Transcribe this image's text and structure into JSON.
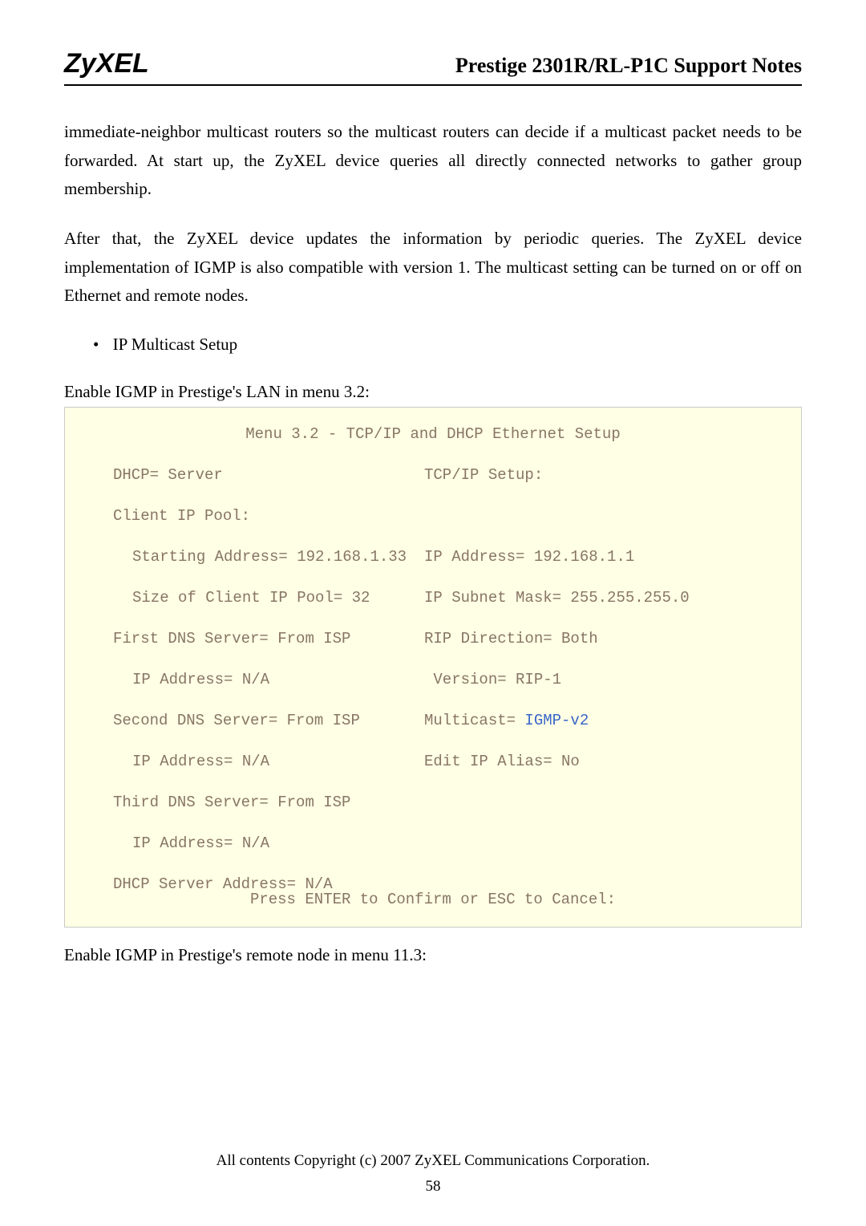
{
  "header": {
    "logo": "ZyXEL",
    "title": "Prestige 2301R/RL-P1C Support Notes"
  },
  "para1": "immediate-neighbor multicast routers so the multicast routers can decide if a multicast packet needs to be forwarded. At start up, the ZyXEL device queries all directly connected networks to gather group membership.",
  "para2": "After that, the ZyXEL device updates the information by periodic queries. The ZyXEL device implementation of IGMP is also compatible with version 1. The multicast setting can be turned on or off on Ethernet and remote nodes.",
  "bullet": "IP Multicast Setup",
  "caption1": "Enable IGMP in Prestige's LAN in menu 3.2:",
  "terminal": {
    "title": "Menu 3.2 - TCP/IP and DHCP Ethernet Setup",
    "rows": [
      {
        "l": "DHCP= Server",
        "r": "TCP/IP Setup:",
        "li": "i1",
        "ri": ""
      },
      {
        "l": "Client IP Pool:",
        "r": "",
        "li": "i1",
        "ri": ""
      },
      {
        "l": "Starting Address= 192.168.1.33",
        "r": "IP Address= 192.168.1.1",
        "li": "i2",
        "ri": ""
      },
      {
        "l": "Size of Client IP Pool= 32",
        "r": "IP Subnet Mask= 255.255.255.0",
        "li": "i2",
        "ri": ""
      },
      {
        "l": "First DNS Server= From ISP",
        "r": "RIP Direction= Both",
        "li": "i1",
        "ri": ""
      },
      {
        "l": "IP Address= N/A",
        "r": " Version= RIP-1",
        "li": "i2",
        "ri": ""
      },
      {
        "l": "Second DNS Server= From ISP",
        "r": "Multicast= ",
        "rhl": "IGMP-v2",
        "li": "i1",
        "ri": ""
      },
      {
        "l": "IP Address= N/A",
        "r": "Edit IP Alias= No",
        "li": "i2",
        "ri": ""
      },
      {
        "l": "Third DNS Server= From ISP",
        "r": "",
        "li": "i1",
        "ri": ""
      },
      {
        "l": "IP Address= N/A",
        "r": "",
        "li": "i2",
        "ri": ""
      },
      {
        "l": "DHCP Server Address= N/A",
        "r": "",
        "li": "i1",
        "ri": ""
      }
    ],
    "footer": "Press ENTER to Confirm or ESC to Cancel:"
  },
  "post": "Enable IGMP in Prestige's remote node in menu 11.3:",
  "copyright": "All contents Copyright (c) 2007 ZyXEL Communications Corporation.",
  "page": "58"
}
